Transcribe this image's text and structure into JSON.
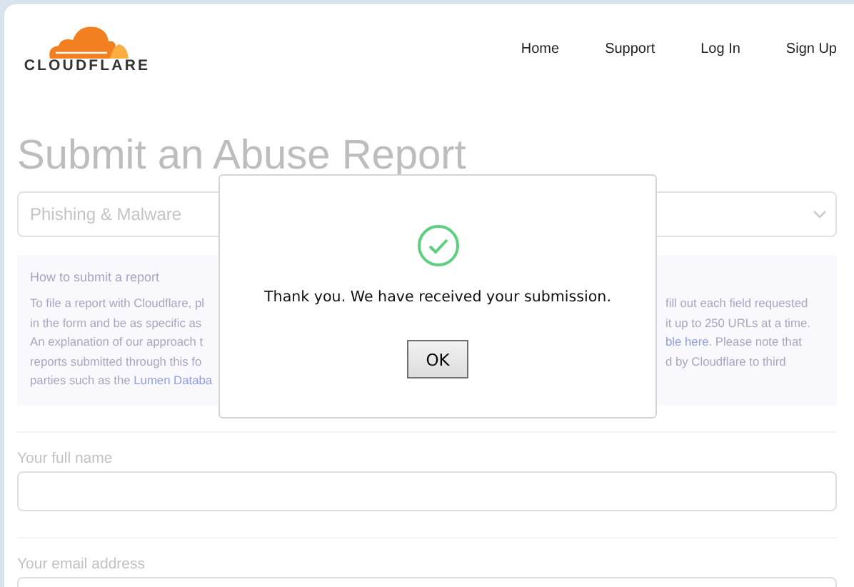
{
  "logo": {
    "text": "CLOUDFLARE"
  },
  "nav": [
    "Home",
    "Support",
    "Log In",
    "Sign Up"
  ],
  "page_title": "Submit an Abuse Report",
  "report_type": {
    "value": "Phishing & Malware"
  },
  "info": {
    "heading": "How to submit a report",
    "lines": [
      {
        "left": [
          {
            "kind": "text",
            "text": "To file a report with Cloudflare, pl"
          }
        ],
        "right": [
          {
            "kind": "text",
            "text": "fill out each field requested"
          }
        ]
      },
      {
        "left": [
          {
            "kind": "text",
            "text": "in the form and be as specific as"
          }
        ],
        "right": [
          {
            "kind": "text",
            "text": "it up to 250 URLs at a time."
          }
        ]
      },
      {
        "left": [
          {
            "kind": "text",
            "text": "An explanation of our approach t"
          }
        ],
        "right": [
          {
            "kind": "link",
            "text": "ble here"
          },
          {
            "kind": "text",
            "text": ". Please note that"
          }
        ]
      },
      {
        "left": [
          {
            "kind": "text",
            "text": "reports submitted through this fo"
          }
        ],
        "right": [
          {
            "kind": "text",
            "text": "d by Cloudflare to third"
          }
        ]
      },
      {
        "left": [
          {
            "kind": "text",
            "text": "parties such as the "
          },
          {
            "kind": "link",
            "text": "Lumen Databa"
          }
        ]
      }
    ]
  },
  "fields": [
    {
      "label": "Your full name"
    },
    {
      "label": "Your email address"
    }
  ],
  "dialog": {
    "message": "Thank you. We have received your submission.",
    "button": "OK"
  }
}
